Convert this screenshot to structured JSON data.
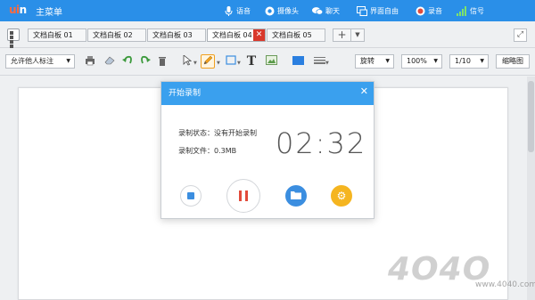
{
  "app": {
    "logo": "uin",
    "main_menu": "主菜单"
  },
  "topbar": {
    "items": [
      {
        "label": "语音",
        "icon": "mic-icon"
      },
      {
        "label": "摄像头",
        "icon": "camera-icon"
      },
      {
        "label": "聊天",
        "icon": "chat-icon"
      },
      {
        "label": "界面自由",
        "icon": "window-icon"
      },
      {
        "label": "录音",
        "icon": "record-icon"
      },
      {
        "label": "信号",
        "icon": "signal-icon"
      }
    ]
  },
  "tabs": [
    {
      "label": "文档白板 01"
    },
    {
      "label": "文档白板 02"
    },
    {
      "label": "文档白板 03"
    },
    {
      "label": "文档白板 04",
      "active": true
    },
    {
      "label": "文档白板 05"
    }
  ],
  "toolbar": {
    "permission_select": "允许他人标注",
    "rotate_label": "旋转",
    "zoom_value": "100%",
    "page_value": "1/10",
    "thumbnail_label": "缩略图"
  },
  "dialog": {
    "title": "开始录制",
    "status_label": "录制状态：",
    "status_value": "没有开始录制",
    "file_label": "录制文件：",
    "file_value": "0.3MB",
    "timer": "02:32"
  },
  "watermark": {
    "text": "4040",
    "url": "www.4040.com"
  },
  "colors": {
    "accent": "#2a8fe8",
    "record_red": "#e24b3b",
    "settings_orange": "#f5b520"
  }
}
